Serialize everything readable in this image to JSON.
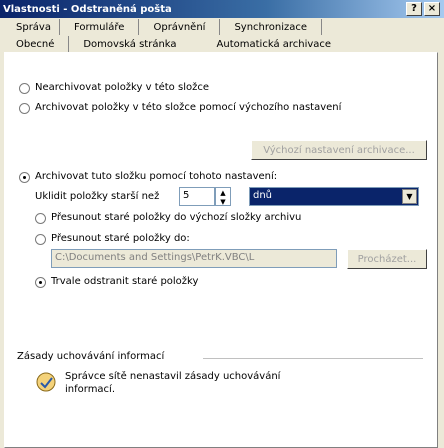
{
  "window": {
    "title": "Vlastnosti - Odstraněná pošta",
    "help_button": "?",
    "close_button": "×"
  },
  "tabs": {
    "row1": [
      "Správa",
      "Formuláře",
      "Oprávnění",
      "Synchronizace"
    ],
    "row2": [
      "Obecné",
      "Domovská stránka",
      "Automatická archivace"
    ]
  },
  "options": {
    "no_archive": "Nearchivovat položky v této složce",
    "default_archive": "Archivovat položky v této složce pomocí výchozího nastavení",
    "default_settings_button": "Výchozí nastavení archivace...",
    "custom_archive": "Archivovat tuto složku pomocí tohoto nastavení:",
    "clean_older_label": "Uklidit položky starší než",
    "clean_older_value": "5",
    "clean_older_unit": "dnů",
    "move_default": "Přesunout staré položky do výchozí složky archivu",
    "move_to": "Přesunout staré položky do:",
    "path_value": "C:\\Documents and Settings\\PetrK.VBC\\L",
    "browse_button": "Procházet...",
    "delete_permanently": "Trvale odstranit staré položky"
  },
  "retention": {
    "header": "Zásady uchovávání informací",
    "message_line1": "Správce sítě nenastavil zásady uchovávání",
    "message_line2": "informací."
  },
  "icons": {
    "info": "retention-policy-icon"
  }
}
